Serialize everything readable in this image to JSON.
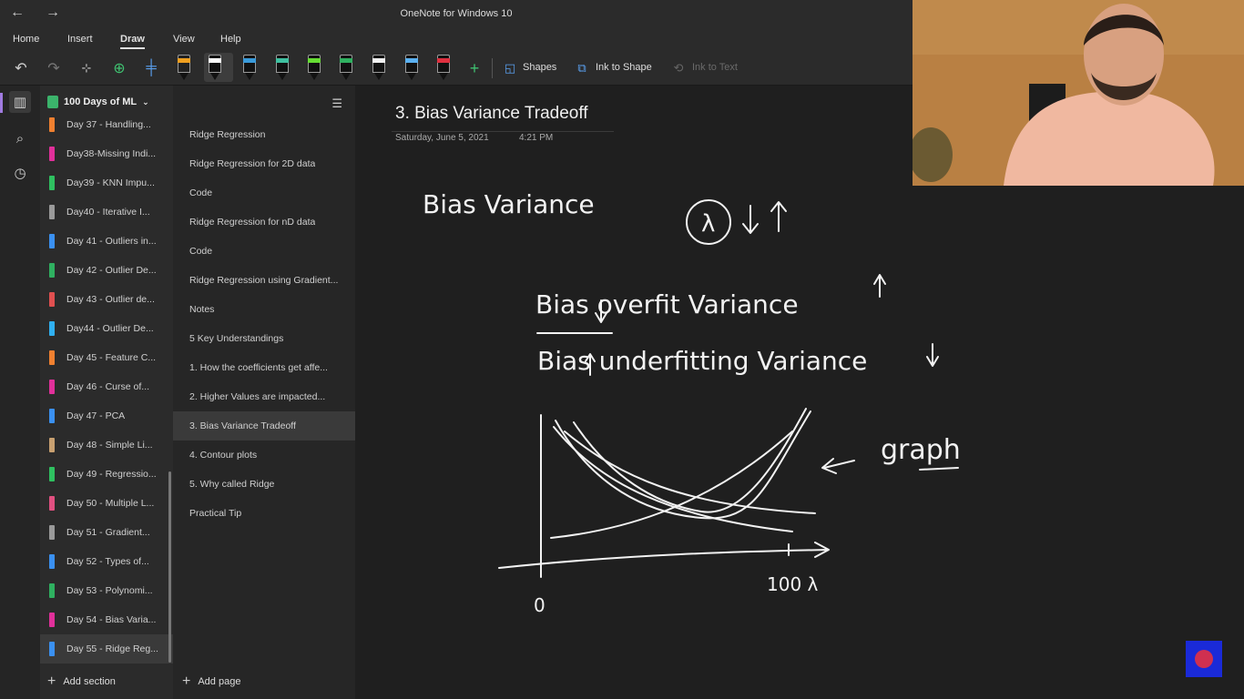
{
  "window": {
    "title": "OneNote for Windows 10"
  },
  "ribbon": {
    "tabs": [
      {
        "label": "Home"
      },
      {
        "label": "Insert"
      },
      {
        "label": "Draw"
      },
      {
        "label": "View"
      },
      {
        "label": "Help"
      }
    ],
    "active_tab": "Draw"
  },
  "toolbar": {
    "shapes_label": "Shapes",
    "ink_to_shape_label": "Ink to Shape",
    "ink_to_text_label": "Ink to Text",
    "pens": [
      {
        "name": "highlighter-orange-pen",
        "color": "#f0a020"
      },
      {
        "name": "white-pen",
        "color": "#ffffff"
      },
      {
        "name": "blue-pen",
        "color": "#3a9ad9"
      },
      {
        "name": "teal-pen",
        "color": "#3fc0a0"
      },
      {
        "name": "green-highlighter",
        "color": "#66dd33"
      },
      {
        "name": "green-pen",
        "color": "#2fb060"
      },
      {
        "name": "white-pen-2",
        "color": "#f0f0f0"
      },
      {
        "name": "light-blue-pen",
        "color": "#5bb0f0"
      },
      {
        "name": "red-pen",
        "color": "#e03040"
      }
    ]
  },
  "notebook": {
    "name": "100 Days of ML"
  },
  "sections": [
    {
      "label": "Day 37 - Handling...",
      "color": "#f08030"
    },
    {
      "label": "Day38-Missing Indi...",
      "color": "#e0309a"
    },
    {
      "label": "Day39 - KNN Impu...",
      "color": "#2fc060"
    },
    {
      "label": "Day40 - Iterative I...",
      "color": "#9a9a9a"
    },
    {
      "label": "Day 41 - Outliers in...",
      "color": "#3a90f0"
    },
    {
      "label": "Day 42 - Outlier De...",
      "color": "#2fb060"
    },
    {
      "label": "Day 43 - Outlier de...",
      "color": "#e05050"
    },
    {
      "label": "Day44 - Outlier De...",
      "color": "#30b0f0"
    },
    {
      "label": "Day 45 - Feature C...",
      "color": "#f08030"
    },
    {
      "label": "Day 46 - Curse of...",
      "color": "#e0309a"
    },
    {
      "label": "Day 47 - PCA",
      "color": "#3a90f0"
    },
    {
      "label": "Day 48 - Simple Li...",
      "color": "#c8a070"
    },
    {
      "label": "Day 49 - Regressio...",
      "color": "#2fc060"
    },
    {
      "label": "Day 50 - Multiple L...",
      "color": "#e05080"
    },
    {
      "label": "Day 51 - Gradient...",
      "color": "#9a9a9a"
    },
    {
      "label": "Day 52 - Types of...",
      "color": "#3a90f0"
    },
    {
      "label": "Day 53 - Polynomi...",
      "color": "#2fb060"
    },
    {
      "label": "Day 54 - Bias Varia...",
      "color": "#e0309a"
    },
    {
      "label": "Day 55 - Ridge Reg...",
      "color": "#3a90f0"
    }
  ],
  "add_section_label": "Add section",
  "pages": [
    {
      "label": "Ridge Regression"
    },
    {
      "label": "Ridge Regression for 2D data"
    },
    {
      "label": "Code"
    },
    {
      "label": "Ridge Regression for nD data"
    },
    {
      "label": "Code"
    },
    {
      "label": "Ridge Regression using Gradient..."
    },
    {
      "label": "Notes"
    },
    {
      "label": "5 Key Understandings"
    },
    {
      "label": "1. How the coefficients get affe..."
    },
    {
      "label": "2. Higher Values are impacted..."
    },
    {
      "label": "3. Bias Variance Tradeoff"
    },
    {
      "label": "4. Contour plots"
    },
    {
      "label": "5. Why called Ridge"
    },
    {
      "label": "Practical Tip"
    }
  ],
  "add_page_label": "Add page",
  "page": {
    "title": "3. Bias Variance Tradeoff",
    "date": "Saturday, June 5, 2021",
    "time": "4:21 PM"
  },
  "ink_notes": {
    "line1": "Bias Variance",
    "lambda_note": "λ ↓ ↑",
    "line2": "Bias ↓ overfit Variance ↑",
    "line3": "Bias ↑ underfitting Variance ↓",
    "graph_label": "← graph",
    "axis_zero": "0",
    "axis_x_label": "100 λ"
  }
}
